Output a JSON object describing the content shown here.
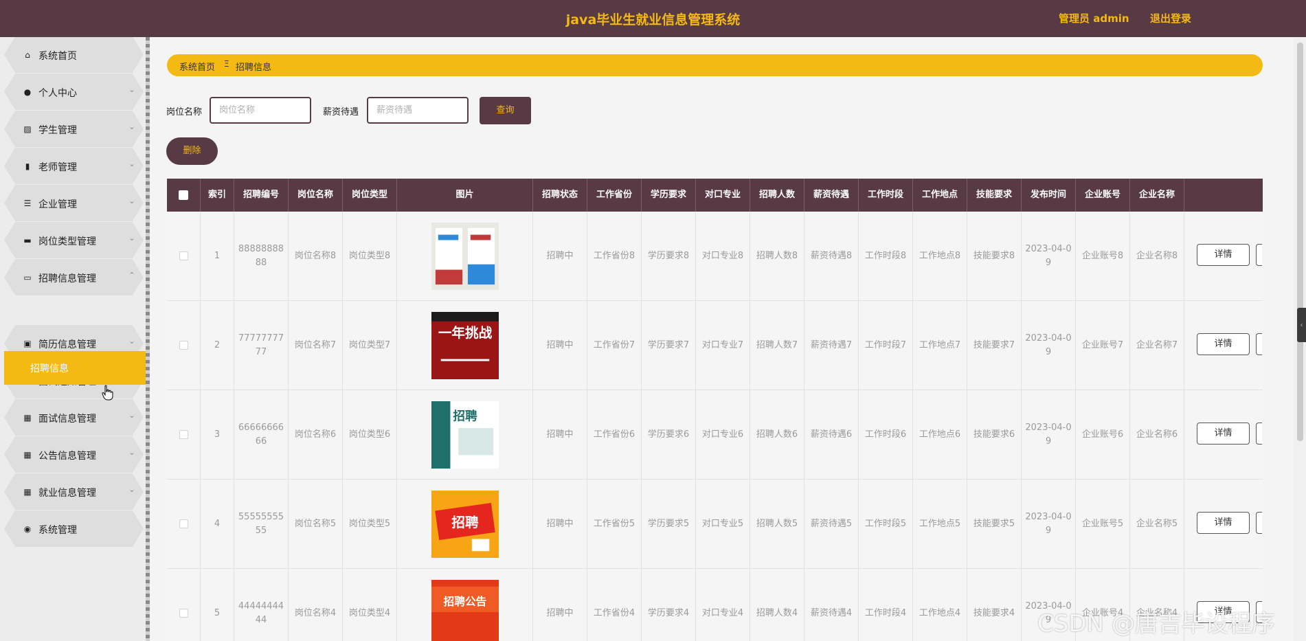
{
  "header": {
    "title": "java毕业生就业信息管理系统",
    "admin": "管理员 admin",
    "logout": "退出登录"
  },
  "sidebar": {
    "items": [
      {
        "label": "系统首页",
        "icon": "home-icon",
        "glyph": "⌂"
      },
      {
        "label": "个人中心",
        "icon": "user-icon",
        "glyph": "●"
      },
      {
        "label": "学生管理",
        "icon": "chart-icon",
        "glyph": "▨"
      },
      {
        "label": "老师管理",
        "icon": "book-icon",
        "glyph": "▮"
      },
      {
        "label": "企业管理",
        "icon": "list-icon",
        "glyph": "☰"
      },
      {
        "label": "岗位类型管理",
        "icon": "message-icon",
        "glyph": "▬"
      },
      {
        "label": "招聘信息管理",
        "icon": "monitor-icon",
        "glyph": "▭"
      },
      {
        "label": "简历信息管理",
        "icon": "clipboard-icon",
        "glyph": "▣"
      },
      {
        "label": "面试通知管理",
        "icon": "briefcase-icon",
        "glyph": "▰"
      },
      {
        "label": "面试信息管理",
        "icon": "grid-icon",
        "glyph": "▦"
      },
      {
        "label": "公告信息管理",
        "icon": "grid-icon",
        "glyph": "▦"
      },
      {
        "label": "就业信息管理",
        "icon": "grid-icon",
        "glyph": "▦"
      },
      {
        "label": "系统管理",
        "icon": "pin-icon",
        "glyph": "◉"
      }
    ],
    "active_sub": "招聘信息"
  },
  "breadcrumb": {
    "home": "系统首页",
    "separator": "Ξ",
    "current": "招聘信息"
  },
  "filters": {
    "position_label": "岗位名称",
    "position_placeholder": "岗位名称",
    "salary_label": "薪资待遇",
    "salary_placeholder": "薪资待遇",
    "search": "查询"
  },
  "actions": {
    "delete": "删除",
    "detail": "详情"
  },
  "table": {
    "columns": [
      "索引",
      "招聘编号",
      "岗位名称",
      "岗位类型",
      "图片",
      "招聘状态",
      "工作省份",
      "学历要求",
      "对口专业",
      "招聘人数",
      "薪资待遇",
      "工作时段",
      "工作地点",
      "技能要求",
      "发布时间",
      "企业账号",
      "企业名称"
    ],
    "rows": [
      {
        "index": "1",
        "code": "8888888888",
        "name": "岗位名称8",
        "type": "岗位类型8",
        "status": "招聘中",
        "province": "工作省份8",
        "edu": "学历要求8",
        "major": "对口专业8",
        "count": "招聘人数8",
        "salary": "薪资待遇8",
        "period": "工作时段8",
        "place": "工作地点8",
        "skill": "技能要求8",
        "date": "2023-04-09",
        "account": "企业账号8",
        "company": "企业名称8",
        "img": {
          "bg": "#eae8e2",
          "c1": "#2e8ad8",
          "c2": "#c23b3b",
          "txt": "",
          "label": ""
        }
      },
      {
        "index": "2",
        "code": "7777777777",
        "name": "岗位名称7",
        "type": "岗位类型7",
        "status": "招聘中",
        "province": "工作省份7",
        "edu": "学历要求7",
        "major": "对口专业7",
        "count": "招聘人数7",
        "salary": "薪资待遇7",
        "period": "工作时段7",
        "place": "工作地点7",
        "skill": "技能要求7",
        "date": "2023-04-09",
        "account": "企业账号7",
        "company": "企业名称7",
        "img": {
          "bg": "#9a1616",
          "c1": "#1b1b1b",
          "c2": "#ffffff",
          "txt": "#ffffff",
          "label": "一年挑战"
        }
      },
      {
        "index": "3",
        "code": "6666666666",
        "name": "岗位名称6",
        "type": "岗位类型6",
        "status": "招聘中",
        "province": "工作省份6",
        "edu": "学历要求6",
        "major": "对口专业6",
        "count": "招聘人数6",
        "salary": "薪资待遇6",
        "period": "工作时段6",
        "place": "工作地点6",
        "skill": "技能要求6",
        "date": "2023-04-09",
        "account": "企业账号6",
        "company": "企业名称6",
        "img": {
          "bg": "#ffffff",
          "c1": "#1f6f6a",
          "c2": "#d8e8e6",
          "txt": "#1f6f6a",
          "label": "招聘"
        }
      },
      {
        "index": "4",
        "code": "5555555555",
        "name": "岗位名称5",
        "type": "岗位类型5",
        "status": "招聘中",
        "province": "工作省份5",
        "edu": "学历要求5",
        "major": "对口专业5",
        "count": "招聘人数5",
        "salary": "薪资待遇5",
        "period": "工作时段5",
        "place": "工作地点5",
        "skill": "技能要求5",
        "date": "2023-04-09",
        "account": "企业账号5",
        "company": "企业名称5",
        "img": {
          "bg": "#f7a515",
          "c1": "#e5261e",
          "c2": "#ffffff",
          "txt": "#ffffff",
          "label": "招聘"
        }
      },
      {
        "index": "5",
        "code": "4444444444",
        "name": "岗位名称4",
        "type": "岗位类型4",
        "status": "招聘中",
        "province": "工作省份4",
        "edu": "学历要求4",
        "major": "对口专业4",
        "count": "招聘人数4",
        "salary": "薪资待遇4",
        "period": "工作时段4",
        "place": "工作地点4",
        "skill": "技能要求4",
        "date": "2023-04-09",
        "account": "企业账号4",
        "company": "企业名称4",
        "img": {
          "bg": "#ef5a25",
          "c1": "#e23a17",
          "c2": "#ffffff",
          "txt": "#ffffff",
          "label": "招聘公告"
        }
      }
    ]
  },
  "watermark": "CSDN @唐吉毕设程序",
  "colors": {
    "brand": "#573a43",
    "accent": "#f5b914"
  }
}
